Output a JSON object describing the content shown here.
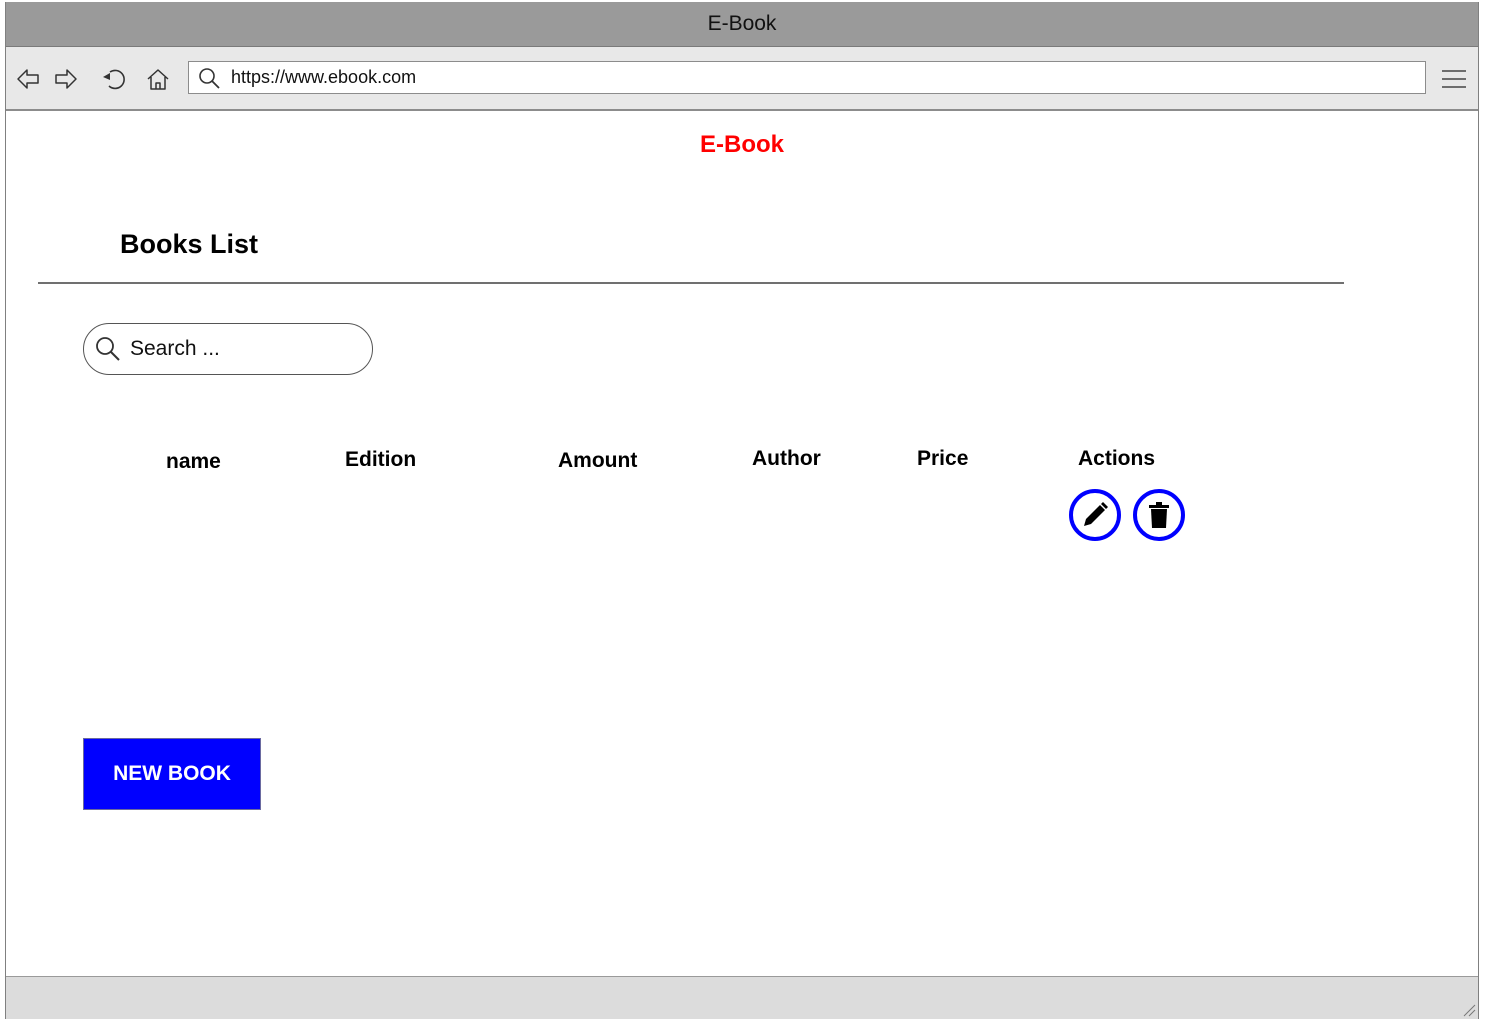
{
  "window": {
    "title": "E-Book"
  },
  "browser": {
    "url": "https://www.ebook.com",
    "nav_icons": [
      "back-icon",
      "forward-icon",
      "reload-icon",
      "home-icon"
    ],
    "menu_icon": "hamburger-menu-icon"
  },
  "app": {
    "title": "E-Book",
    "title_color": "#ff0000"
  },
  "page": {
    "title": "Books List",
    "search_placeholder": "Search ..."
  },
  "table": {
    "headers": [
      "name",
      "Edition",
      "Amount",
      "Author",
      "Price",
      "Actions"
    ],
    "actions": [
      "edit-icon",
      "delete-icon"
    ],
    "action_color": "#0000ff"
  },
  "buttons": {
    "new_book": "NEW BOOK",
    "new_book_color": "#0000ff"
  }
}
